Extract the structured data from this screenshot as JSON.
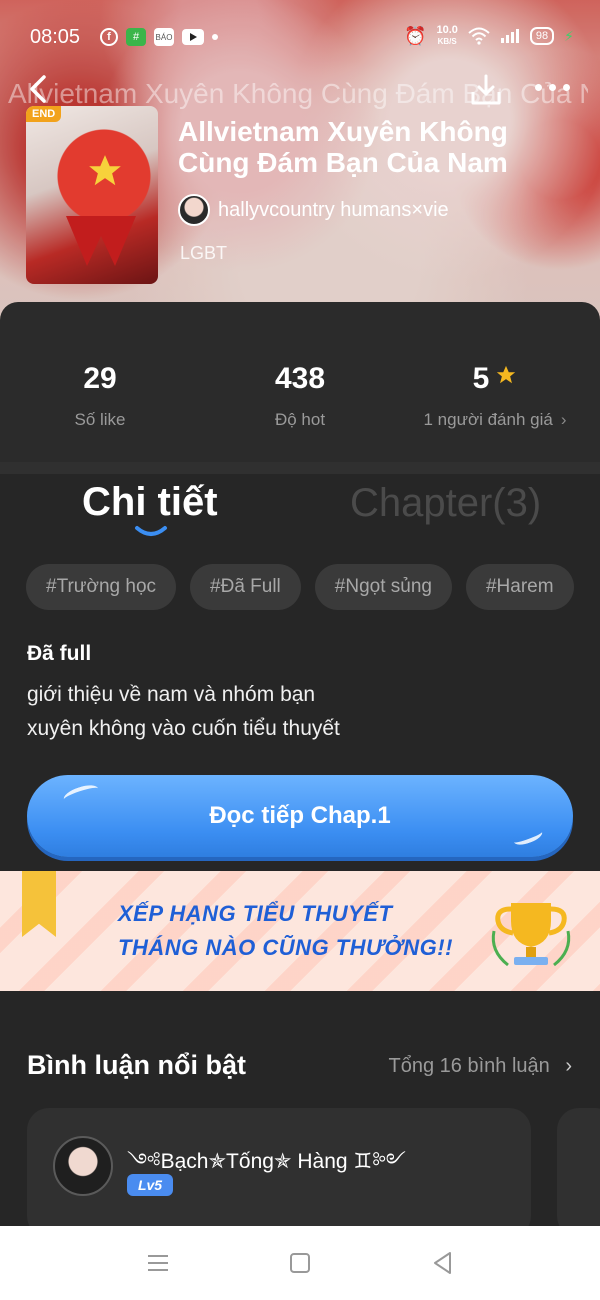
{
  "status_bar": {
    "time": "08:05",
    "net_speed": "10.0",
    "net_unit": "KB/S",
    "battery": "98"
  },
  "header": {
    "ghost_title": "Allvietnam Xuyên Không Cùng Đám Bạn Của Nam",
    "cover_badge": "END",
    "title": "Allvietnam Xuyên Không Cùng Đám Bạn Của Nam",
    "author": "hallyvcountry humans×vie",
    "genre": "LGBT"
  },
  "stats": {
    "likes_value": "29",
    "likes_label": "Số like",
    "hot_value": "438",
    "hot_label": "Độ hot",
    "rating_value": "5",
    "rating_label": "1 người đánh giá"
  },
  "tabs": {
    "detail": "Chi tiết",
    "chapters": "Chapter(3)"
  },
  "tags": [
    "#Trường học",
    "#Đã Full",
    "#Ngọt sủng",
    "#Harem"
  ],
  "description": {
    "status": "Đã full",
    "line1": "giới thiệu về nam và nhóm bạn",
    "line2": "xuyên không vào cuốn tiểu thuyết"
  },
  "read_button": "Đọc tiếp Chap.1",
  "banner": {
    "line1": "XẾP HẠNG TIỂU THUYẾT",
    "line2": "THÁNG NÀO CŨNG THƯỞNG!!"
  },
  "comments": {
    "title": "Bình luận nổi bật",
    "total": "Tổng 16 bình luận",
    "first_user": "༺Bạch✯Tống✯ Hàng ♊༻",
    "first_level": "Lv5"
  },
  "colors": {
    "background": "#262626",
    "accent_blue": "#3b8ef2",
    "star_yellow": "#f5b820",
    "banner_bg": "#fde6dd"
  }
}
